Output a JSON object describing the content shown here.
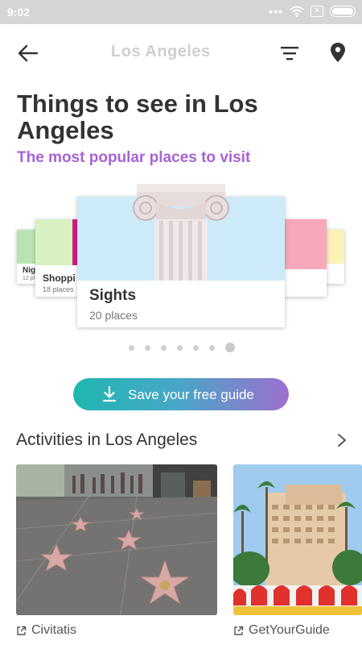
{
  "status_bar": {
    "time": "9:02"
  },
  "header": {
    "title": "Los Angeles"
  },
  "main": {
    "title": "Things to see in Los Angeles",
    "subtitle": "The most popular places to visit"
  },
  "carousel": {
    "cards": [
      {
        "name": "Nig",
        "count": "12 pl",
        "color": "#b9e4b1"
      },
      {
        "name": "Shoppi",
        "count": "18 places",
        "color": "#d8f1c0"
      },
      {
        "name": "Sights",
        "count": "20 places",
        "color": "#cdeaf8"
      },
      {
        "name": "",
        "count": "",
        "color": "#f7a9bb"
      },
      {
        "name": "",
        "count": "",
        "color": "#fbf2b8"
      }
    ],
    "pages": 7,
    "active_page": 7
  },
  "cta": {
    "label": "Save your free guide"
  },
  "activities": {
    "title": "Activities in Los Angeles",
    "items": [
      {
        "provider": "Civitatis"
      },
      {
        "provider": "GetYourGuide"
      }
    ]
  },
  "colors": {
    "accent": "#a862d4",
    "cta_start": "#1fb7b0",
    "cta_end": "#9d6fcf"
  }
}
